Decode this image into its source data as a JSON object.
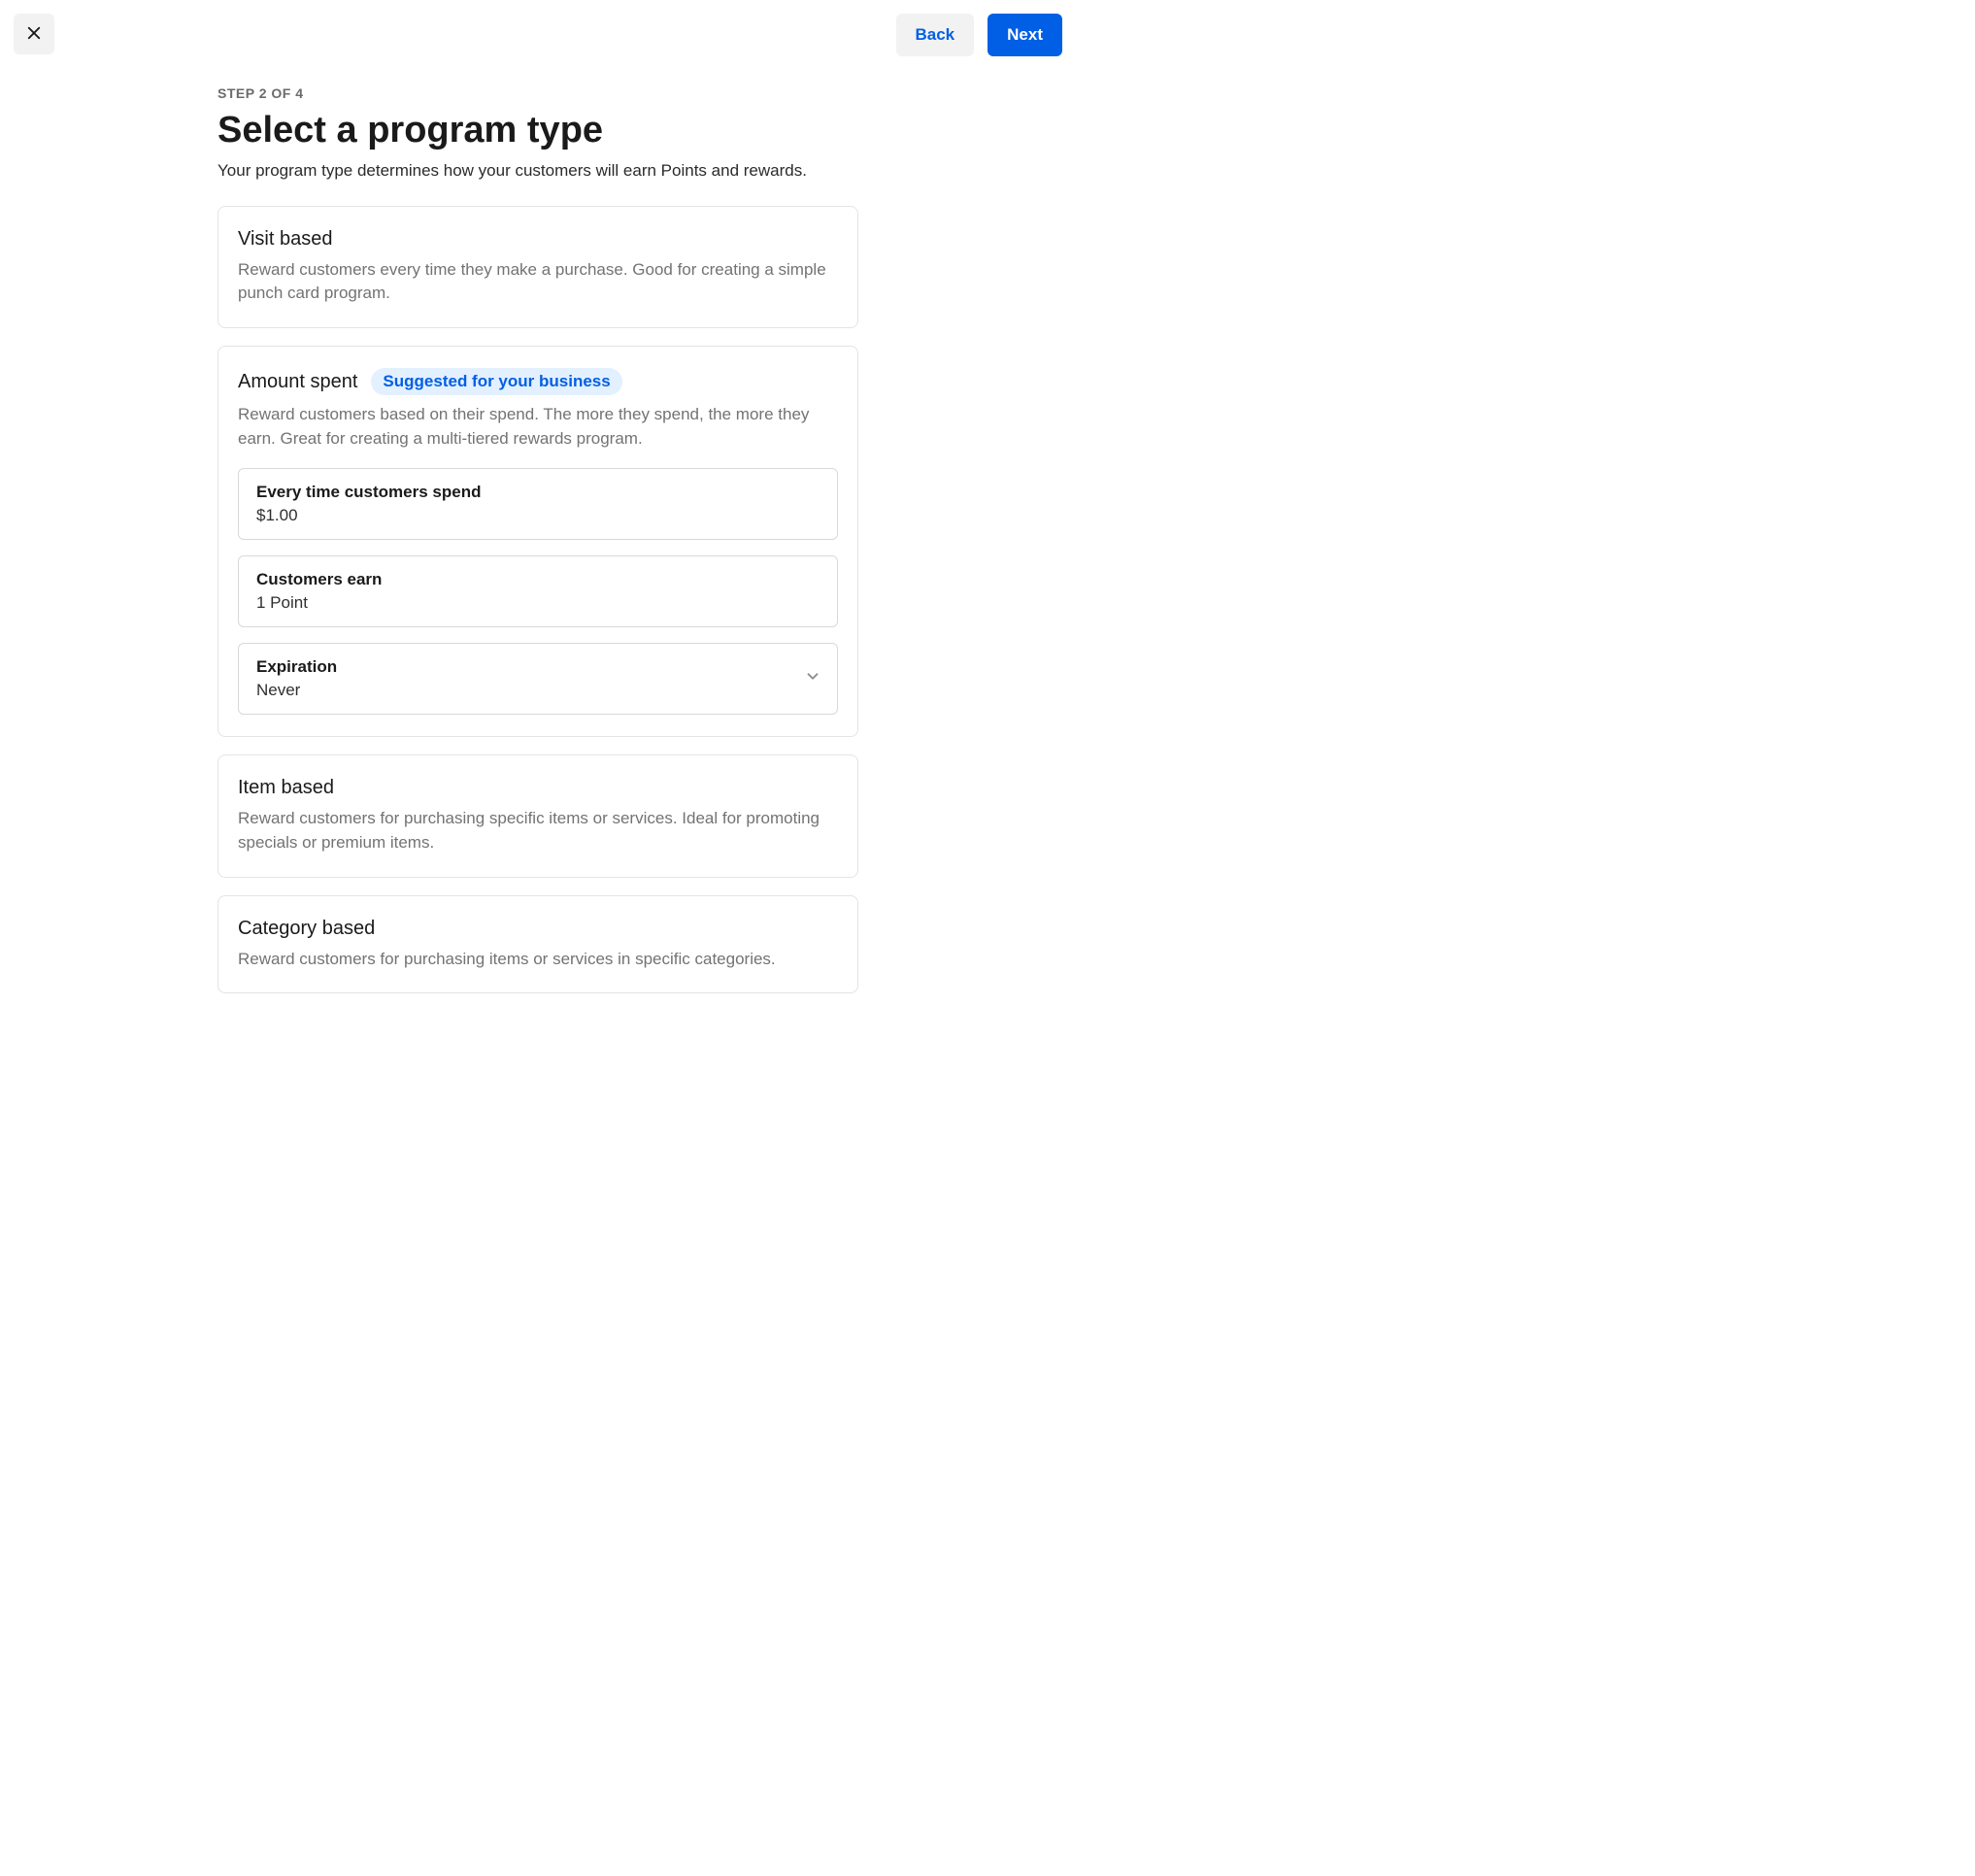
{
  "header": {
    "back_label": "Back",
    "next_label": "Next"
  },
  "step": {
    "label": "STEP 2 OF 4",
    "title": "Select a program type",
    "subtitle": "Your program type determines how your customers will earn Points and rewards."
  },
  "options": {
    "visit": {
      "title": "Visit based",
      "desc": "Reward customers every time they make a purchase. Good for creating a simple punch card program."
    },
    "amount": {
      "title": "Amount spent",
      "badge": "Suggested for your business",
      "desc": "Reward customers based on their spend. The more they spend, the more they earn. Great for creating a multi-tiered rewards program.",
      "fields": {
        "spend": {
          "label": "Every time customers spend",
          "value": "$1.00"
        },
        "earn": {
          "label": "Customers earn",
          "value": "1 Point"
        },
        "exp": {
          "label": "Expiration",
          "value": "Never"
        }
      }
    },
    "item": {
      "title": "Item based",
      "desc": "Reward customers for purchasing specific items or services. Ideal for promoting specials or premium items."
    },
    "category": {
      "title": "Category based",
      "desc": "Reward customers for purchasing items or services in specific categories."
    }
  }
}
